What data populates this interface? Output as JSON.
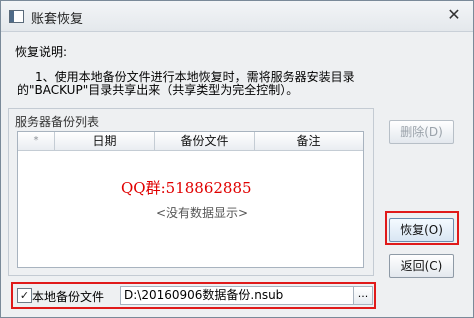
{
  "window": {
    "title": "账套恢复",
    "close_glyph": "✕",
    "icon": "app-window-icon"
  },
  "description": {
    "title": "恢复说明:",
    "line1": "1、使用本地备份文件进行本地恢复时，需将服务器安装目录",
    "line2": "的\"BACKUP\"目录共享出来（共享类型为完全控制）。"
  },
  "server_backup": {
    "group_title": "服务器备份列表",
    "columns": [
      "*",
      "日期",
      "备份文件",
      "备注"
    ],
    "rows": [],
    "overlay_text": "QQ群:518862885",
    "empty_text": "<没有数据显示>"
  },
  "buttons": {
    "delete": "删除(D)",
    "restore": "恢复(O)",
    "back": "返回(C)"
  },
  "local_backup": {
    "checkbox_checked": true,
    "checkbox_glyph": "✓",
    "label": "本地备份文件",
    "path_value": "D:\\20160906数据备份.nsub",
    "browse_label": "..."
  },
  "colors": {
    "highlight": "#e01a1a",
    "overlay_text": "#e00000"
  }
}
